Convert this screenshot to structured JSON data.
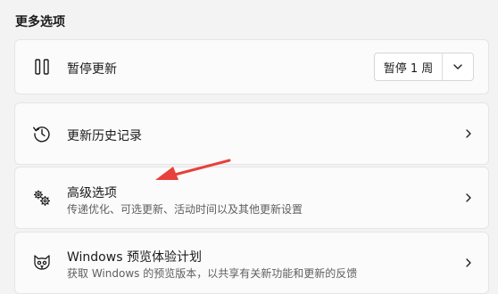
{
  "section": {
    "title": "更多选项"
  },
  "pause": {
    "label": "暂停更新",
    "dropdown_value": "暂停 1 周",
    "icon": "pause-icon"
  },
  "history": {
    "label": "更新历史记录",
    "icon": "history-icon"
  },
  "advanced": {
    "label": "高级选项",
    "description": "传递优化、可选更新、活动时间以及其他更新设置",
    "icon": "gears-icon"
  },
  "insider": {
    "label": "Windows 预览体验计划",
    "description": "获取 Windows 的预览版本，以共享有关新功能和更新的反馈",
    "icon": "insider-cat-icon"
  },
  "colors": {
    "annotation_arrow": "#e8403a"
  }
}
